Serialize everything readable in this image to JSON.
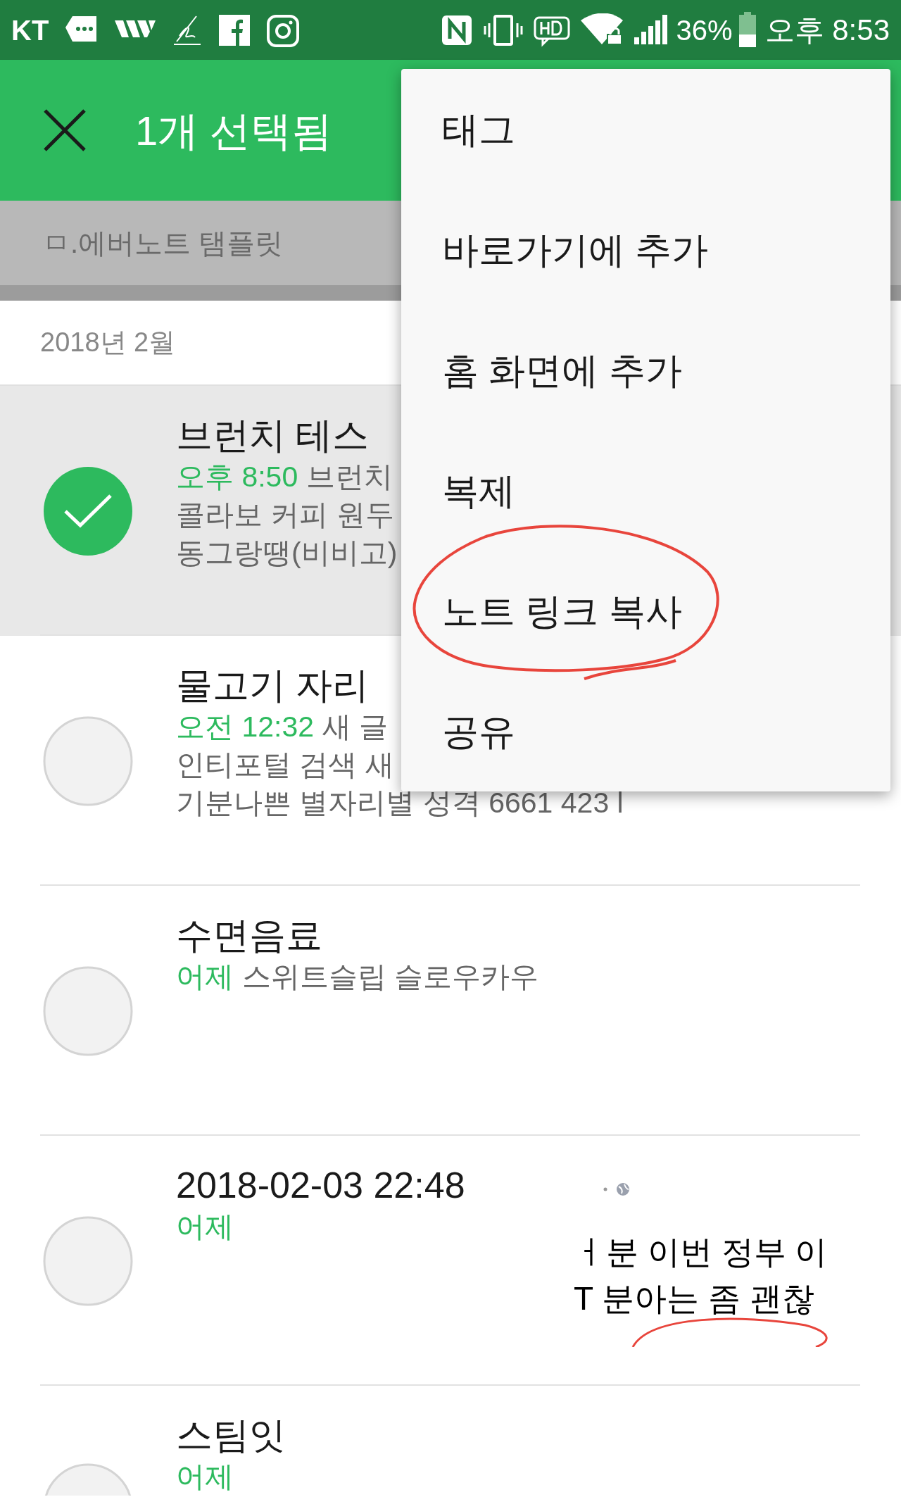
{
  "status_bar": {
    "carrier": "KT",
    "battery": "36%",
    "time": "오후 8:53"
  },
  "app_bar": {
    "title": "1개 선택됨"
  },
  "notebook_bar": {
    "label": "ㅁ.에버노트 탬플릿"
  },
  "section_header": "2018년 2월",
  "notes": [
    {
      "title": "브런치 테스",
      "time": "오후 8:50",
      "snippet": "브런치",
      "more_lines": [
        "콜라보 커피 원두",
        "동그랑땡(비비고)"
      ],
      "selected": true
    },
    {
      "title": "물고기 자리",
      "time": "오전 12:32",
      "snippet": "새 글",
      "more_lines": [
        "인티포털  검색  새",
        "기분나쁜 별자리별 성격 6661  423  l"
      ],
      "selected": false
    },
    {
      "title": "수면음료",
      "time": "어제",
      "snippet": "스위트슬립  슬로우카우",
      "selected": false
    },
    {
      "title": "2018-02-03 22:48",
      "time": "어제",
      "selected": false,
      "thumbnail": {
        "lines": [
          "ㅓ분 이번 정부 이",
          "T 분아는 좀 괜찮"
        ]
      }
    },
    {
      "title": "스팀잇",
      "time": "어제",
      "selected": false
    }
  ],
  "menu": {
    "items": [
      {
        "label": "태그",
        "circled": false
      },
      {
        "label": "바로가기에 추가",
        "circled": false
      },
      {
        "label": "홈 화면에 추가",
        "circled": false
      },
      {
        "label": "복제",
        "circled": false
      },
      {
        "label": "노트 링크 복사",
        "circled": true
      },
      {
        "label": "공유",
        "circled": false
      }
    ]
  }
}
